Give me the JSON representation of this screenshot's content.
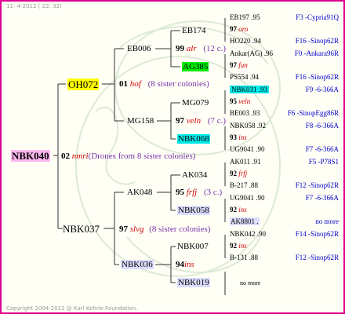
{
  "header": {
    "date": "11- 4-2012 ( 22: 32)"
  },
  "footer": {
    "copyright": "Copyright 2004-2012 @ Karl Kehrle Foundation."
  },
  "root": {
    "id": "NBK040",
    "gen": "02",
    "breeder": "nmri",
    "note": "(Drones from 8 sister colonies)"
  },
  "g1": {
    "upper": "OH072",
    "lower": "NBK037"
  },
  "g1u": {
    "gen": "01",
    "breeder": "hof",
    "note": "(8 sister colonies)"
  },
  "g1l": {
    "gen": "97",
    "breeder": "slvg",
    "note": "(8 sister colonies)"
  },
  "g2": {
    "a": "EB006",
    "b": "MG158",
    "c": "AK048",
    "d": "NBK036"
  },
  "g2a": {
    "gen": "99",
    "breeder": "alr",
    "note": "(12 c.)"
  },
  "g2b": {
    "gen": "97",
    "breeder": "veln",
    "note": "(7 c.)"
  },
  "g2c": {
    "gen": "95",
    "breeder": "frfj",
    "note": "(3 c.)"
  },
  "g2d": {
    "gen": "94",
    "breeder": "ins"
  },
  "g3": {
    "a": "EB174",
    "b": "AG385",
    "c": "MG079",
    "d": "NBK068",
    "e": "AK034",
    "f": "NBK058",
    "g": "NBK007",
    "h": "NBK019"
  },
  "g4": {
    "b1": {
      "top": "EB197 .95",
      "gen": "97",
      "breeder": "oro",
      "bot": "HO220 .94",
      "o1": "F3 -Cypria91Q",
      "o2": "F16 -Sinop62R"
    },
    "b2": {
      "top": "Ankar(AG) .96",
      "gen": "97",
      "breeder": "fun",
      "bot": "PS554 .94",
      "o1": "F0 -Ankara96R",
      "o2": "F16 -Sinop62R"
    },
    "b3": {
      "top": "NBK031 .93",
      "gen": "95",
      "breeder": "veln",
      "bot": "BE003 .93",
      "o1": "F9 -6-366A",
      "o2": "F6 -SinopEgg86R"
    },
    "b4": {
      "top": "NBK058 .92",
      "gen": "93",
      "breeder": "ins",
      "bot": "UG9041 .90",
      "o1": "F8 -6-366A",
      "o2": "F7 -6-366A"
    },
    "b5": {
      "top": "AK011 .91",
      "gen": "92",
      "breeder": "frfj",
      "bot": "B-217 .88",
      "o1": "F5 -P78S1",
      "o2": "F12 -Sinop62R"
    },
    "b6": {
      "top": "UG9041 .90",
      "gen": "92",
      "breeder": "ins",
      "bot": "AK8801 .",
      "o1": "F7 -6-366A",
      "o2": "no more"
    },
    "b7": {
      "top": "NBK042 .90",
      "gen": "92",
      "breeder": "ins",
      "bot": "B-131 .88",
      "o1": "F14 -Sinop62R",
      "o2": "F12 -Sinop62R"
    },
    "b8": {
      "mid": "no more"
    }
  },
  "colors": {
    "frame": "#e0008f",
    "root_highlight": "#ffb8f0",
    "yellow": "#ffff00",
    "green": "#00ee00",
    "cyan": "#00eaea",
    "lavender": "#dcdcff",
    "breeder_red": "#d00000",
    "note_purple": "#7733aa",
    "origin_blue": "#0000cc"
  }
}
